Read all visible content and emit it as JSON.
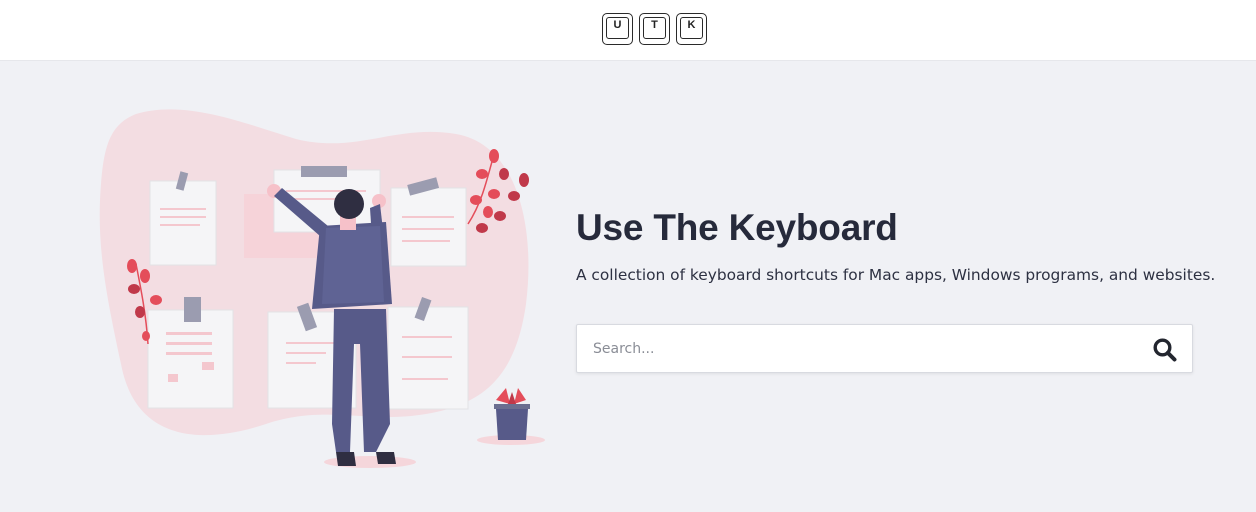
{
  "logo": {
    "keys": [
      "U",
      "T",
      "K"
    ]
  },
  "hero": {
    "title": "Use The Keyboard",
    "subtitle": "A collection of keyboard shortcuts for Mac apps, Windows programs, and websites."
  },
  "search": {
    "placeholder": "Search...",
    "value": "",
    "icon": "search-icon"
  },
  "colors": {
    "accent": "#e44d5a",
    "blob": "#f3dde2",
    "figure": "#575a89",
    "heading": "#262a3b"
  }
}
